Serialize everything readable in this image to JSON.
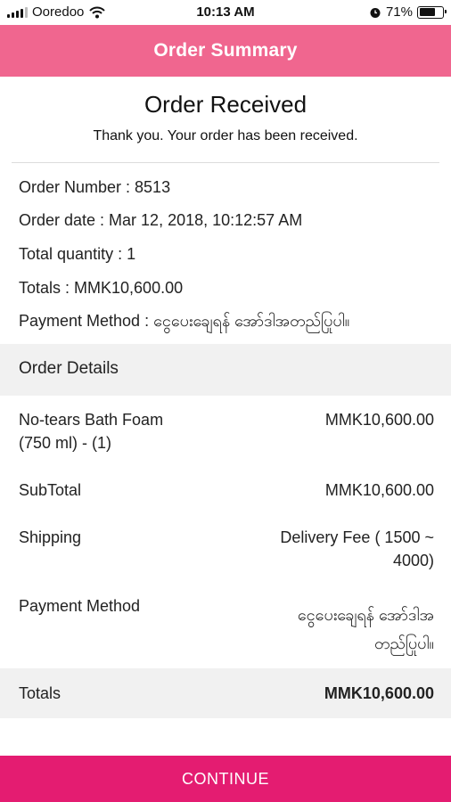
{
  "status_bar": {
    "carrier": "Ooredoo",
    "time": "10:13 AM",
    "battery": "71%",
    "battery_level": 0.71
  },
  "header": {
    "title": "Order Summary"
  },
  "received": {
    "title": "Order Received",
    "message": "Thank you. Your order has been received."
  },
  "order_info": {
    "number": "Order Number : 8513",
    "date": "Order date : Mar 12, 2018, 10:12:57 AM",
    "quantity": "Total quantity : 1",
    "totals": "Totals : MMK10,600.00",
    "payment": "Payment Method : ငွေပေးချေရန် အော်ဒါအတည်ပြုပါ။"
  },
  "details": {
    "section_title": "Order Details",
    "item_name_line1": "No-tears Bath Foam",
    "item_name_line2": "(750 ml) - (1)",
    "item_price": "MMK10,600.00",
    "subtotal_label": "SubTotal",
    "subtotal_value": "MMK10,600.00",
    "shipping_label": "Shipping",
    "shipping_value_line1": "Delivery Fee ( 1500 ~",
    "shipping_value_line2": "4000)",
    "payment_label": "Payment Method",
    "payment_value_line1": "ငွေပေးချေရန် အော်ဒါအ",
    "payment_value_line2": "တည်ပြုပါ။",
    "totals_label": "Totals",
    "totals_value": "MMK10,600.00"
  },
  "footer": {
    "continue_label": "CONTINUE"
  },
  "colors": {
    "header_pink": "#f0668f",
    "button_magenta": "#e41c71",
    "band_gray": "#f1f1f1"
  }
}
